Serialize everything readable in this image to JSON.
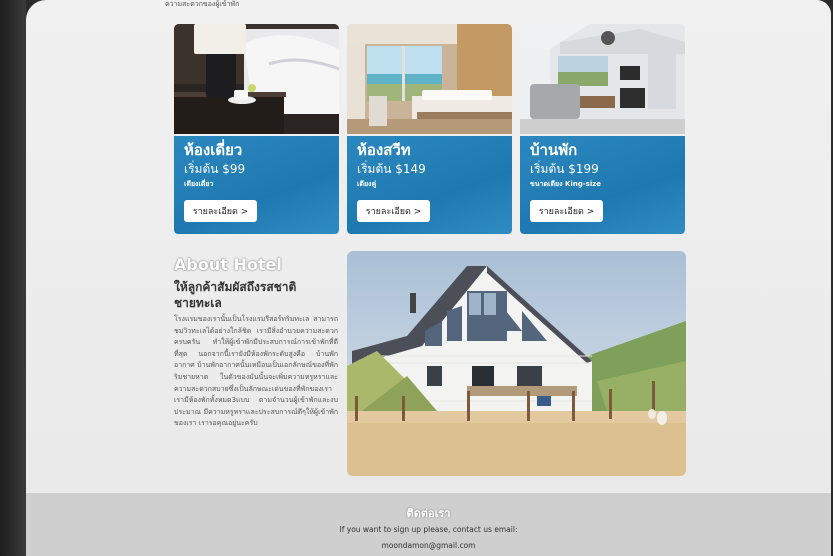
{
  "header": {
    "top_text": "ความสะดวกของผู้เข้าพัก"
  },
  "rooms": [
    {
      "title": "ห้องเดี่ยว",
      "price": "เริ่มต้น $99",
      "bed": "เตียงเดี่ยว",
      "button": "รายละเอียด >"
    },
    {
      "title": "ห้องสวีท",
      "price": "เริ่มต้น $149",
      "bed": "เตียงคู่",
      "button": "รายละเอียด >"
    },
    {
      "title": "บ้านพัก",
      "price": "เริ่มต้น $199",
      "bed": "ขนาดเตียง King-size",
      "button": "รายละเอียด >"
    }
  ],
  "about": {
    "heading": "About Hotel",
    "subheading": "ให้ลูกค้าสัมผัสถึงรสชาติชายทะเล",
    "body": "โรงแรมของเรานั้นเป็นโรงแรมรีสอร์ทริมทะเล สามารถชมวิวทะเลได้อย่างใกล้ชิด เรามีสิ่งอำนวยความสะดวกครบครัน ทำให้ผู้เข้าพักมีประสบการณ์การเข้าพักที่ดีที่สุด นอกจากนี้เรายังมีห้องพักระดับสูงคือ บ้านพักอากาศ บ้านพักอากาศนั้นเหมือนเป็นเอกลักษณ์ของที่พักริมชายหาด ในตัวของมันนั้นจะเพิ่มความหรูหราและความสะดวกสบายซึ่งเป็นลักษณะเด่นของที่พักของเรา เรามีห้องพักทั้งหมด3แบบ ตามจำนวนผู้เข้าพักและงบประมาณ มีความหรูหราและประสบการณ์ดีๆให้ผู้เข้าพักของเรา เรารอคุณอยู่นะครับ"
  },
  "footer": {
    "title": "ติดต่อเรา",
    "line1": "If you want to sign up please, contact us email:",
    "email": "moondamon@gmail.com"
  }
}
